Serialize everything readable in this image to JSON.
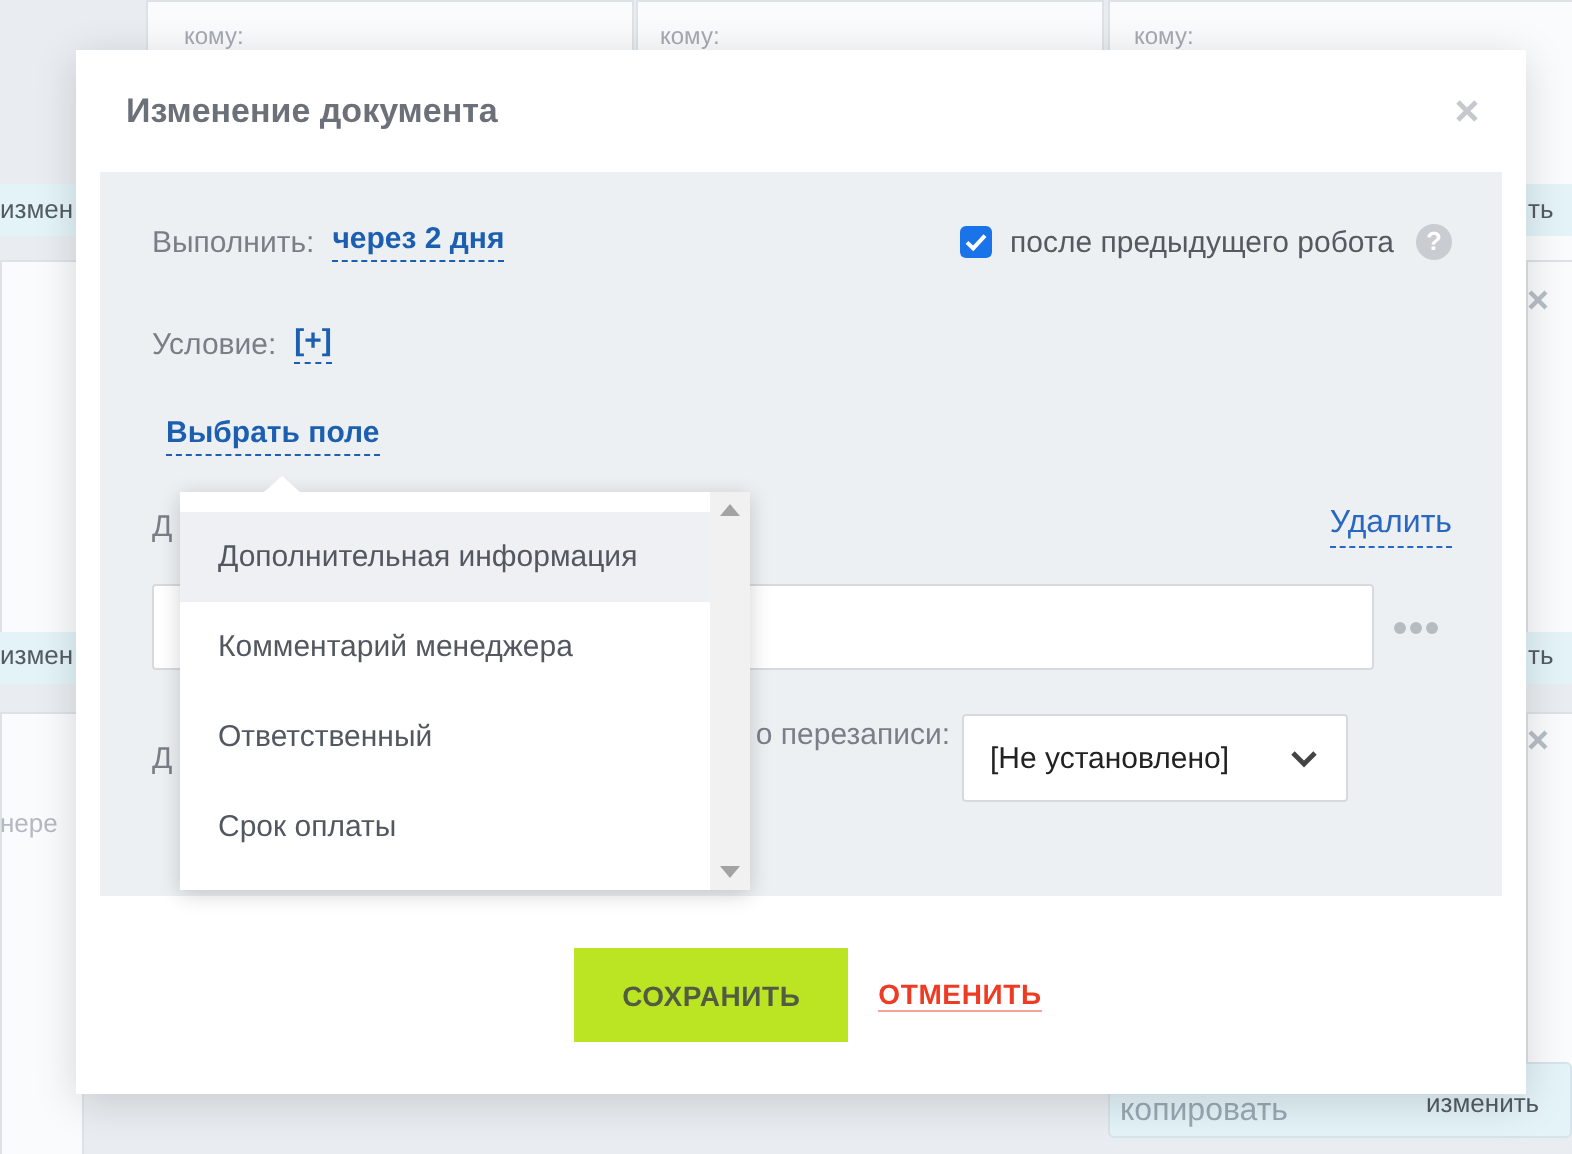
{
  "background": {
    "recipient_labels": [
      "кому:",
      "кому:",
      "кому:"
    ],
    "left_fragments": [
      "измен",
      "измен",
      "нере"
    ],
    "right_fragments": [
      "ть",
      "ть"
    ],
    "footer_buttons": [
      "копировать",
      "изменить"
    ]
  },
  "dialog": {
    "title": "Изменение документа",
    "execute": {
      "label": "Выполнить:",
      "value": "через 2 дня"
    },
    "after_previous": {
      "label": "после предыдущего робота",
      "checked": true,
      "help": "?"
    },
    "condition": {
      "label": "Условие:",
      "action": "[+]"
    },
    "choose_field": "Выбрать поле",
    "field_row": {
      "label": "Д",
      "remove": "Удалить"
    },
    "overwrite_row": {
      "label_start": "Д",
      "label_end": "о перезаписи:",
      "value": "[Не установлено]"
    },
    "dropdown": {
      "items": [
        {
          "label": "Дополнительная информация",
          "selected": true
        },
        {
          "label": "Комментарий менеджера",
          "selected": false
        },
        {
          "label": "Ответственный",
          "selected": false
        },
        {
          "label": "Срок оплаты",
          "selected": false
        }
      ]
    },
    "buttons": {
      "save": "СОХРАНИТЬ",
      "cancel": "ОТМЕНИТЬ"
    }
  }
}
